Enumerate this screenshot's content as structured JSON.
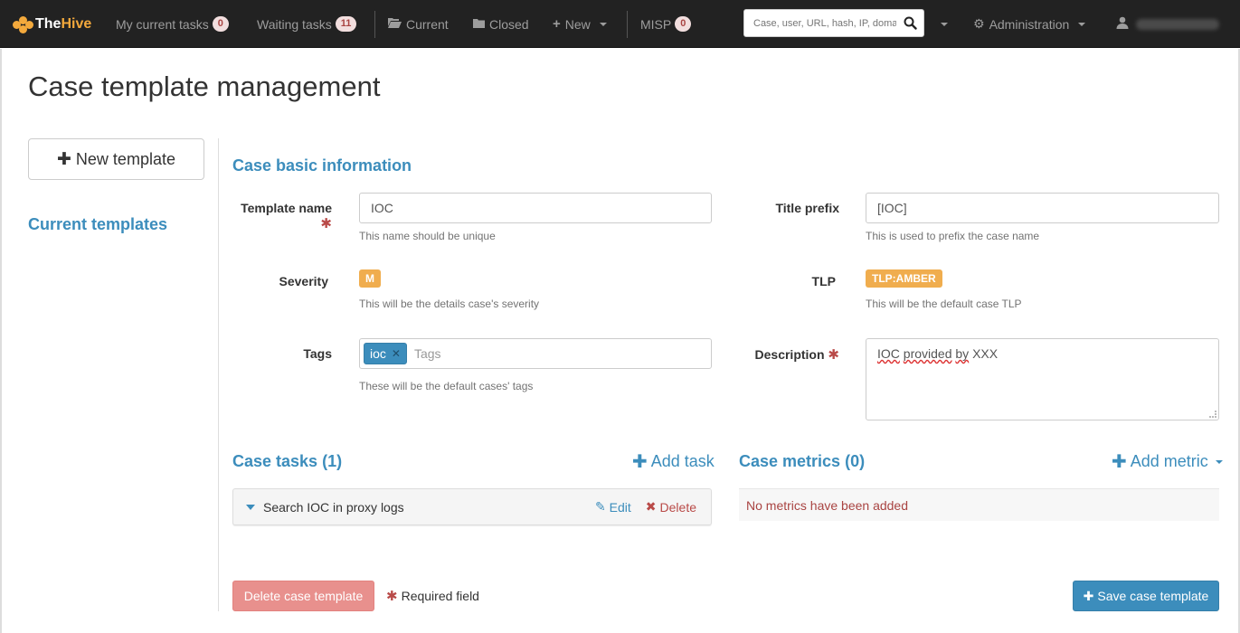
{
  "navbar": {
    "brand_the": "The",
    "brand_hive": "Hive",
    "my_tasks_label": "My current tasks",
    "my_tasks_count": "0",
    "waiting_tasks_label": "Waiting tasks",
    "waiting_tasks_count": "11",
    "current_label": "Current",
    "closed_label": "Closed",
    "new_label": "New",
    "misp_label": "MISP",
    "misp_count": "0",
    "search_placeholder": "Case, user, URL, hash, IP, domain...",
    "admin_label": "Administration",
    "icons": {
      "current": "folder-open-icon",
      "closed": "folder-icon",
      "new": "plus-icon",
      "search": "search-icon",
      "admin": "gear-icon",
      "user": "user-icon"
    }
  },
  "page": {
    "title": "Case template management",
    "new_template_label": "New template",
    "current_templates_label": "Current templates"
  },
  "basic_info": {
    "section_title": "Case basic information",
    "template_name_label": "Template name",
    "template_name_value": "IOC",
    "template_name_help": "This name should be unique",
    "title_prefix_label": "Title prefix",
    "title_prefix_value": "[IOC]",
    "title_prefix_help": "This is used to prefix the case name",
    "severity_label": "Severity",
    "severity_value": "M",
    "severity_help": "This will be the details case's severity",
    "tlp_label": "TLP",
    "tlp_value": "TLP:AMBER",
    "tlp_help": "This will be the default case TLP",
    "tags_label": "Tags",
    "tags": [
      "ioc"
    ],
    "tags_placeholder": "Tags",
    "tags_help": "These will be the default cases' tags",
    "description_label": "Description",
    "description_words": [
      "IOC",
      "provided",
      "by",
      "XXX"
    ]
  },
  "tasks": {
    "section_title": "Case tasks (1)",
    "add_label": "Add task",
    "items": [
      {
        "name": "Search IOC in proxy logs",
        "edit_label": "Edit",
        "delete_label": "Delete"
      }
    ]
  },
  "metrics": {
    "section_title": "Case metrics (0)",
    "add_label": "Add metric",
    "empty_text": "No metrics have been added"
  },
  "footer": {
    "delete_label": "Delete case template",
    "required_label": "Required field",
    "save_label": "Save case template"
  },
  "colors": {
    "navbar_bg": "#222222",
    "accent": "#3c8dbc",
    "warning": "#f0ad4e",
    "danger": "#b94a48"
  }
}
